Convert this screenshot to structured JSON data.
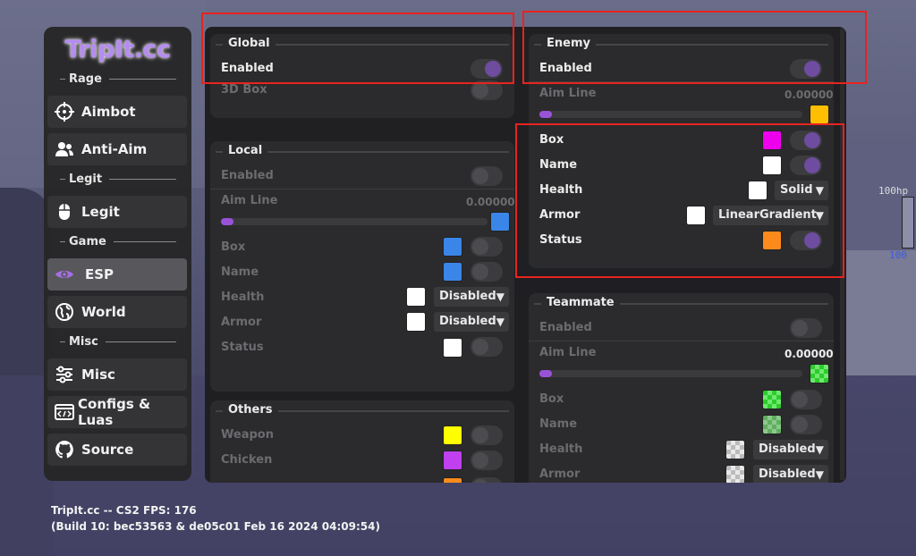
{
  "brand": {
    "logo_text": "TripIt.cc"
  },
  "sidebar": {
    "sections": [
      {
        "title": "Rage",
        "items": [
          {
            "label": "Aimbot",
            "icon": "crosshair-icon"
          },
          {
            "label": "Anti-Aim",
            "icon": "users-icon"
          }
        ]
      },
      {
        "title": "Legit",
        "items": [
          {
            "label": "Legit",
            "icon": "mouse-icon"
          }
        ]
      },
      {
        "title": "Game",
        "items": [
          {
            "label": "ESP",
            "icon": "eye-icon",
            "active": true
          },
          {
            "label": "World",
            "icon": "globe-icon"
          }
        ]
      },
      {
        "title": "Misc",
        "items": [
          {
            "label": "Misc",
            "icon": "sliders-icon"
          },
          {
            "label": "Configs & Luas",
            "icon": "code-icon"
          },
          {
            "label": "Source",
            "icon": "github-icon"
          }
        ]
      }
    ]
  },
  "global": {
    "title": "Global",
    "enabled_label": "Enabled",
    "enabled": true,
    "box3d_label": "3D Box",
    "box3d": false
  },
  "local": {
    "title": "Local",
    "enabled_label": "Enabled",
    "enabled": false,
    "aim_line_label": "Aim Line",
    "aim_line_value": "0.00000",
    "aim_line_color": "#3a86e8",
    "box_label": "Box",
    "box_color": "#3a86e8",
    "name_label": "Name",
    "name_color": "#3a86e8",
    "health_label": "Health",
    "health_color": "#ffffff",
    "health_mode": "Disabled",
    "armor_label": "Armor",
    "armor_color": "#ffffff",
    "armor_mode": "Disabled",
    "status_label": "Status",
    "status_color": "#ffffff"
  },
  "others": {
    "title": "Others",
    "weapon_label": "Weapon",
    "weapon_color": "#ffff00",
    "chicken_label": "Chicken",
    "chicken_color": "#c040f0"
  },
  "enemy": {
    "title": "Enemy",
    "enabled_label": "Enabled",
    "enabled": true,
    "aim_line_label": "Aim Line",
    "aim_line_value": "0.00000",
    "aim_line_color": "#ffbf00",
    "box_label": "Box",
    "box_color": "#ee00ee",
    "name_label": "Name",
    "name_color": "#ffffff",
    "health_label": "Health",
    "health_color": "#ffffff",
    "health_mode": "Solid",
    "armor_label": "Armor",
    "armor_color": "#ffffff",
    "armor_mode": "LinearGradient",
    "status_label": "Status",
    "status_color": "#ff8a1c"
  },
  "teammate": {
    "title": "Teammate",
    "enabled_label": "Enabled",
    "enabled": false,
    "aim_line_label": "Aim Line",
    "aim_line_value": "0.00000",
    "box_label": "Box",
    "name_label": "Name",
    "health_label": "Health",
    "health_mode": "Disabled",
    "armor_label": "Armor",
    "armor_mode": "Disabled"
  },
  "footer": {
    "line1": "TripIt.cc -- CS2 FPS: 176",
    "line2": "(Build 10: bec53563 & de05c01 Feb 16 2024 04:09:54)"
  },
  "hud": {
    "hp_text": "100hp",
    "hp_value": "100"
  },
  "dropdown_arrow": "▼",
  "colors": {
    "accent": "#6e4c9f",
    "highlight_box": "#e8231f",
    "slider": "#9a52d8"
  }
}
